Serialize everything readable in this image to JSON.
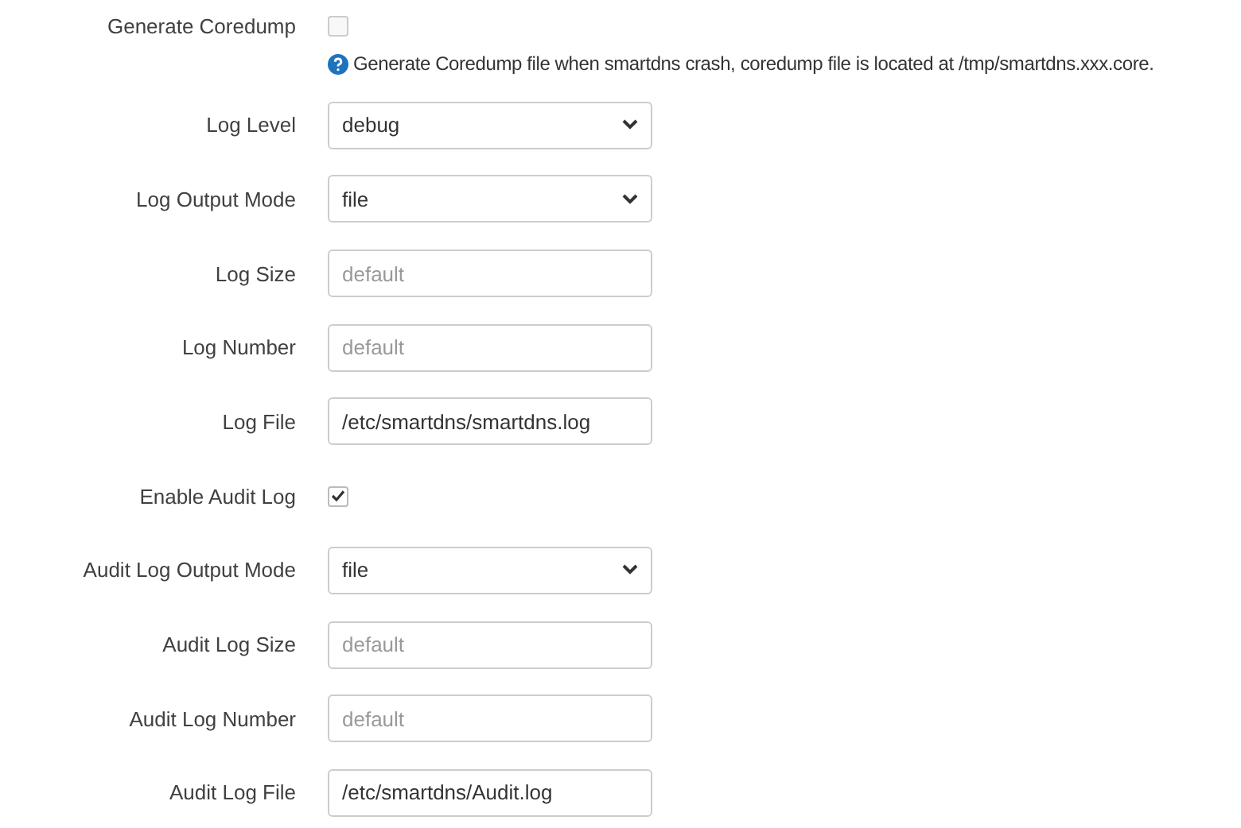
{
  "fields": [
    {
      "kind": "checkbox",
      "label": "Generate Coredump",
      "checked": false,
      "help": "Generate Coredump file when smartdns crash, coredump file is located at /tmp/smartdns.xxx.core."
    },
    {
      "kind": "select",
      "label": "Log Level",
      "value": "debug"
    },
    {
      "kind": "select",
      "label": "Log Output Mode",
      "value": "file"
    },
    {
      "kind": "text",
      "label": "Log Size",
      "placeholder": "default"
    },
    {
      "kind": "text",
      "label": "Log Number",
      "placeholder": "default"
    },
    {
      "kind": "text",
      "label": "Log File",
      "value": "/etc/smartdns/smartdns.log"
    },
    {
      "kind": "checkbox",
      "label": "Enable Audit Log",
      "checked": true
    },
    {
      "kind": "select",
      "label": "Audit Log Output Mode",
      "value": "file"
    },
    {
      "kind": "text",
      "label": "Audit Log Size",
      "placeholder": "default"
    },
    {
      "kind": "text",
      "label": "Audit Log Number",
      "placeholder": "default"
    },
    {
      "kind": "text",
      "label": "Audit Log File",
      "value": "/etc/smartdns/Audit.log"
    }
  ]
}
